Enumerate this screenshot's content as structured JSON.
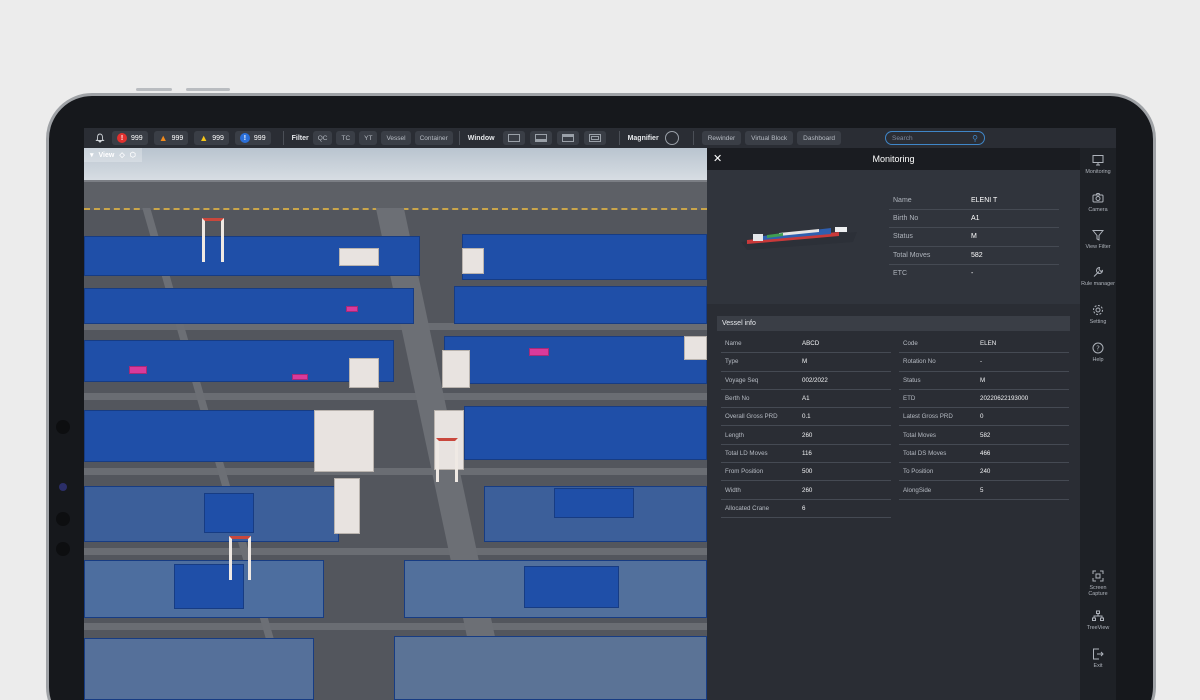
{
  "toolbar": {
    "alerts": [
      {
        "icon": "error-alert-icon",
        "color": "#e0302e",
        "symbol": "!",
        "count": "999"
      },
      {
        "icon": "warning-alert-icon",
        "color": "#f08a1c",
        "symbol": "!",
        "count": "999"
      },
      {
        "icon": "caution-alert-icon",
        "color": "#f5c518",
        "symbol": "!",
        "count": "999"
      },
      {
        "icon": "info-alert-icon",
        "color": "#2b6fd8",
        "symbol": "!",
        "count": "999"
      }
    ],
    "filter_label": "Filter",
    "filters": [
      "QC",
      "TC",
      "YT",
      "Vessel",
      "Container"
    ],
    "window_label": "Window",
    "magnifier_label": "Magnifier",
    "actions": [
      "Rewinder",
      "Virtual Block",
      "Dashboard"
    ],
    "search_placeholder": "Search"
  },
  "view": {
    "label": "View"
  },
  "monitoring": {
    "title": "Monitoring",
    "summary": [
      {
        "k": "Name",
        "v": "ELENI T"
      },
      {
        "k": "Birth No",
        "v": "A1"
      },
      {
        "k": "Status",
        "v": "M"
      },
      {
        "k": "Total Moves",
        "v": "582"
      },
      {
        "k": "ETC",
        "v": "-"
      }
    ],
    "vessel_info_title": "Vessel info",
    "vessel_info_left": [
      {
        "k": "Name",
        "v": "ABCD"
      },
      {
        "k": "Type",
        "v": "M"
      },
      {
        "k": "Voyage Seq",
        "v": "002/2022"
      },
      {
        "k": "Berth No",
        "v": "A1"
      },
      {
        "k": "Overall Gross PRD",
        "v": "0.1"
      },
      {
        "k": "Length",
        "v": "260"
      },
      {
        "k": "Total LD Moves",
        "v": "116"
      },
      {
        "k": "From Position",
        "v": "500"
      },
      {
        "k": "Width",
        "v": "260"
      },
      {
        "k": "Allocated Crane",
        "v": "6"
      }
    ],
    "vessel_info_right": [
      {
        "k": "Code",
        "v": "ELEN"
      },
      {
        "k": "Rotation No",
        "v": "-"
      },
      {
        "k": "Status",
        "v": "M"
      },
      {
        "k": "ETD",
        "v": "20220622193000"
      },
      {
        "k": "Latest Gross PRD",
        "v": "0"
      },
      {
        "k": "Total Moves",
        "v": "582"
      },
      {
        "k": "Total DS Moves",
        "v": "466"
      },
      {
        "k": "To Position",
        "v": "240"
      },
      {
        "k": "AlongSide",
        "v": "5"
      }
    ]
  },
  "rail": {
    "top": [
      {
        "icon": "monitor-icon",
        "label": "Monitoring"
      },
      {
        "icon": "camera-icon",
        "label": "Camera"
      },
      {
        "icon": "filter-icon",
        "label": "View Filter"
      },
      {
        "icon": "wrench-icon",
        "label": "Rule manager"
      },
      {
        "icon": "gear-icon",
        "label": "Setting"
      },
      {
        "icon": "help-icon",
        "label": "Help"
      }
    ],
    "bottom": [
      {
        "icon": "screen-capture-icon",
        "label": "Screen Capture"
      },
      {
        "icon": "tree-icon",
        "label": "TreeView"
      },
      {
        "icon": "exit-icon",
        "label": "Exit"
      }
    ]
  }
}
